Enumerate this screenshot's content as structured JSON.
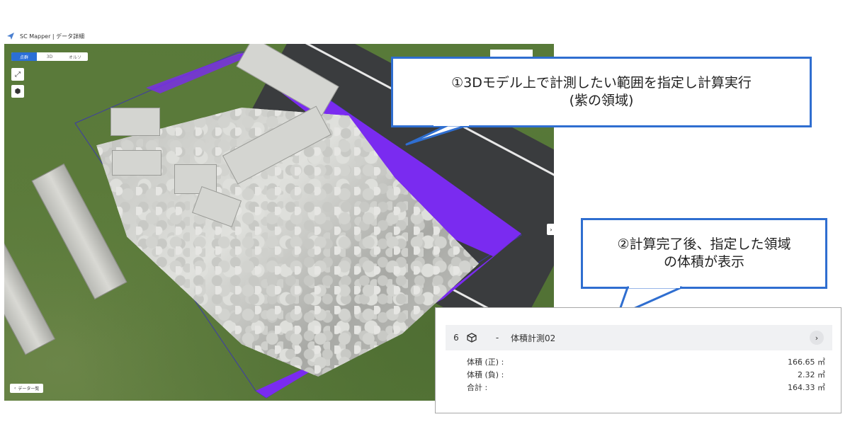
{
  "app": {
    "title": "SC Mapper | データ詳細",
    "logo_icon": "paper-plane-icon"
  },
  "map": {
    "tabs": [
      {
        "label": "点群",
        "active": true
      },
      {
        "label": "3D",
        "active": false
      },
      {
        "label": "オルソ",
        "active": false
      }
    ],
    "tools": [
      "expand-icon",
      "hexagon-icon"
    ],
    "data_list_label": "データ一覧",
    "overlay_color": "#7a2bf0"
  },
  "callouts": {
    "step1": {
      "line1": "①3Dモデル上で計測したい範囲を指定し計算実行",
      "line2": "(紫の領域)"
    },
    "step2": {
      "line1": "②計算完了後、指定した領域",
      "line2": "の体積が表示"
    }
  },
  "volume_panel": {
    "index": "6",
    "dash": "-",
    "title": "体積計測02",
    "rows": [
      {
        "label": "体積 (正) :",
        "value": "166.65 ㎥"
      },
      {
        "label": "体積 (負) :",
        "value": "2.32 ㎥"
      },
      {
        "label": "合計 :",
        "value": "164.33 ㎥"
      }
    ]
  },
  "colors": {
    "callout_border": "#2f6ed0",
    "active_tab": "#2b6fd6",
    "purple": "#7a2bf0"
  }
}
